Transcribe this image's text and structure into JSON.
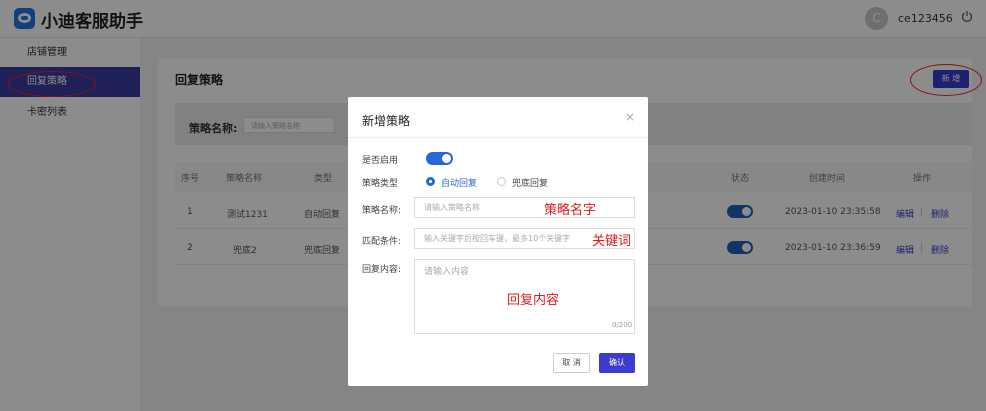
{
  "app": {
    "title": "小迪客服助手",
    "avatar_letter": "C",
    "username": "ce123456"
  },
  "sidebar": {
    "items": [
      {
        "label": "店铺管理"
      },
      {
        "label": "回复策略"
      },
      {
        "label": "卡密列表"
      }
    ]
  },
  "page": {
    "title": "回复策略",
    "new_button": "新 增",
    "filter": {
      "label": "策略名称:",
      "placeholder": "请输入策略名称"
    }
  },
  "table": {
    "columns": [
      "序号",
      "策略名称",
      "类型",
      "状态",
      "创建时间",
      "操作"
    ],
    "rows": [
      {
        "index": "1",
        "name": "测试1231",
        "type": "自动回复",
        "status_on": true,
        "created": "2023-01-10 23:35:58",
        "edit": "编辑",
        "delete": "删除"
      },
      {
        "index": "2",
        "name": "兜底2",
        "type": "兜底回复",
        "status_on": true,
        "created": "2023-01-10 23:36:59",
        "edit": "编辑",
        "delete": "删除"
      }
    ]
  },
  "modal": {
    "title": "新增策略",
    "enabled_label": "是否启用",
    "enabled": true,
    "type_label": "策略类型",
    "type_options": [
      "自动回复",
      "兜底回复"
    ],
    "type_selected": "自动回复",
    "name_label": "策略名称:",
    "name_placeholder": "请输入策略名称",
    "match_label": "匹配条件:",
    "match_placeholder": "输入关键字后按回车键，最多10个关键字",
    "reply_label": "回复内容:",
    "reply_placeholder": "请输入内容",
    "reply_counter": "0/200",
    "cancel": "取 消",
    "confirm": "确认"
  },
  "annotations": {
    "name": "策略名字",
    "keyword": "关键词",
    "content": "回复内容"
  },
  "colors": {
    "accent": "#3b3bd0",
    "sidebar_active": "#3b3ba0",
    "annotation": "#e01a1a"
  }
}
